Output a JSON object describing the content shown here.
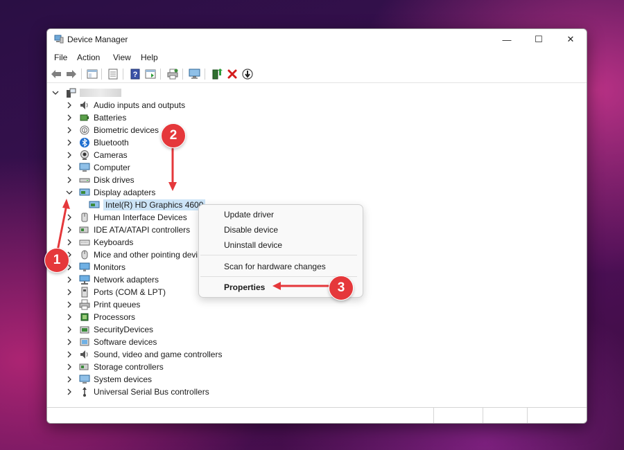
{
  "window": {
    "title": "Device Manager",
    "minimize": "—",
    "maximize": "☐",
    "close": "✕"
  },
  "menu": [
    "File",
    "Action",
    "View",
    "Help"
  ],
  "toolbar_icons": [
    "back-icon",
    "forward-icon",
    "show-hide-console-tree-icon",
    "properties-sheet-icon",
    "help-icon",
    "show-action-pane-icon",
    "print-icon",
    "scan-hardware-icon",
    "update-driver-icon",
    "uninstall-device-icon",
    "disable-device-icon"
  ],
  "tree": {
    "root_label": "",
    "categories": [
      {
        "label": "Audio inputs and outputs",
        "icon": "speaker-icon"
      },
      {
        "label": "Batteries",
        "icon": "battery-icon"
      },
      {
        "label": "Biometric devices",
        "icon": "fingerprint-icon"
      },
      {
        "label": "Bluetooth",
        "icon": "bluetooth-icon"
      },
      {
        "label": "Cameras",
        "icon": "camera-icon"
      },
      {
        "label": "Computer",
        "icon": "computer-icon"
      },
      {
        "label": "Disk drives",
        "icon": "disk-drive-icon"
      },
      {
        "label": "Display adapters",
        "icon": "display-adapter-icon",
        "expanded": true
      },
      {
        "label": "Intel(R) HD Graphics 4600",
        "icon": "display-adapter-icon",
        "child": true,
        "selected": true
      },
      {
        "label": "Human Interface Devices",
        "icon": "hid-icon"
      },
      {
        "label": "IDE ATA/ATAPI controllers",
        "icon": "ide-controller-icon"
      },
      {
        "label": "Keyboards",
        "icon": "keyboard-icon"
      },
      {
        "label": "Mice and other pointing devi",
        "icon": "mouse-icon"
      },
      {
        "label": "Monitors",
        "icon": "monitor-icon"
      },
      {
        "label": "Network adapters",
        "icon": "network-adapter-icon"
      },
      {
        "label": "Ports (COM & LPT)",
        "icon": "port-icon"
      },
      {
        "label": "Print queues",
        "icon": "printer-icon"
      },
      {
        "label": "Processors",
        "icon": "processor-icon"
      },
      {
        "label": "SecurityDevices",
        "icon": "security-device-icon"
      },
      {
        "label": "Software devices",
        "icon": "software-device-icon"
      },
      {
        "label": "Sound, video and game controllers",
        "icon": "sound-icon"
      },
      {
        "label": "Storage controllers",
        "icon": "storage-controller-icon"
      },
      {
        "label": "System devices",
        "icon": "system-device-icon"
      },
      {
        "label": "Universal Serial Bus controllers",
        "icon": "usb-icon"
      }
    ]
  },
  "context_menu": {
    "update_driver": "Update driver",
    "disable_device": "Disable device",
    "uninstall_device": "Uninstall device",
    "scan_hardware": "Scan for hardware changes",
    "properties": "Properties"
  },
  "annotations": [
    "1",
    "2",
    "3"
  ],
  "colors": {
    "accent_red": "#e5383b",
    "selection": "#cce4f7"
  }
}
